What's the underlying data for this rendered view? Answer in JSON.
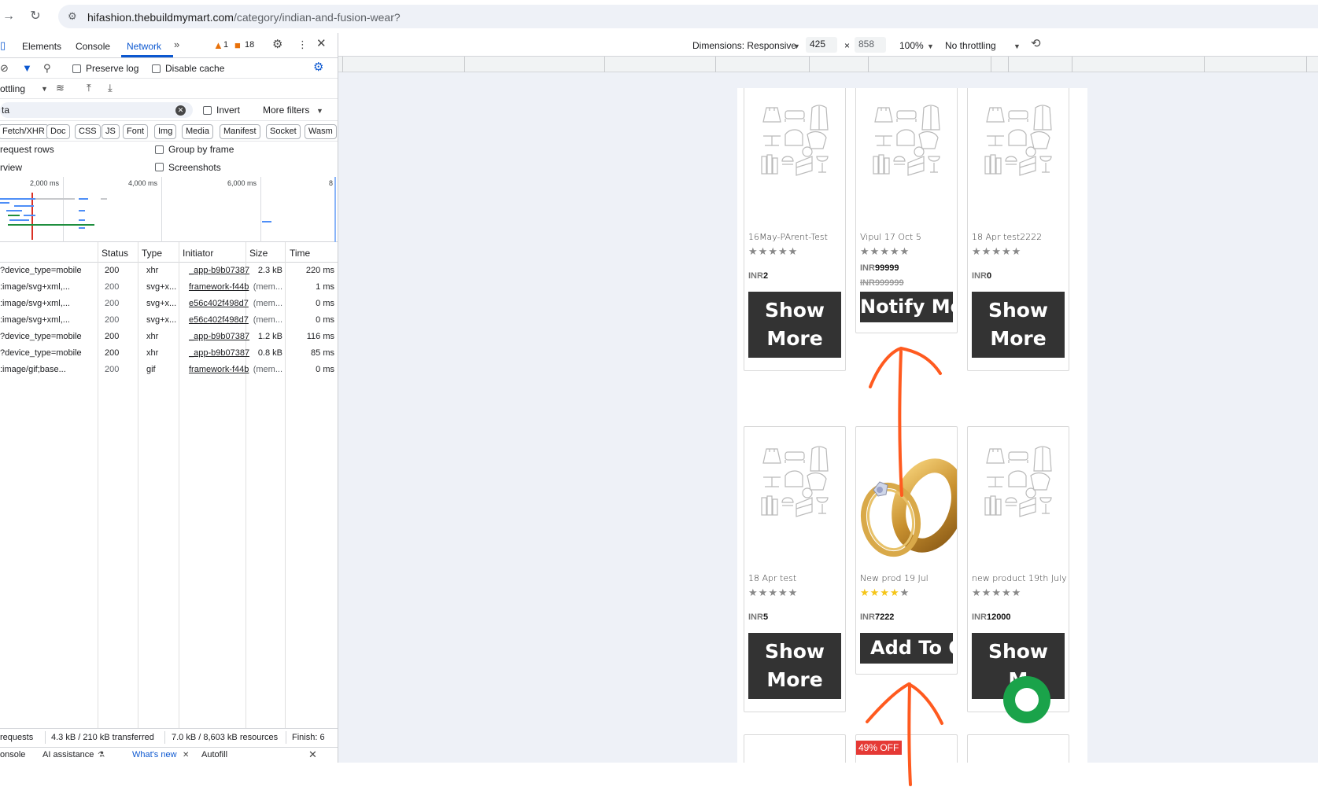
{
  "browser": {
    "url_host": "hifashion.thebuildmymart.com",
    "url_path": "/category/indian-and-fusion-wear?",
    "back_icon": "back-arrow-icon",
    "reload_icon": "reload-icon"
  },
  "devtools": {
    "tabs": [
      "Elements",
      "Console",
      "Network"
    ],
    "warnings_count": "1",
    "issues_count": "18",
    "preserve_log": "Preserve log",
    "disable_cache": "Disable cache",
    "throttling": "ottling",
    "filter_value": "ta",
    "invert": "Invert",
    "more_filters": "More filters",
    "chips": [
      "Fetch/XHR",
      "Doc",
      "CSS",
      "JS",
      "Font",
      "Img",
      "Media",
      "Manifest",
      "Socket",
      "Wasm"
    ],
    "big_request_rows": "request rows",
    "group_by_frame": "Group by frame",
    "overview": "rview",
    "screenshots": "Screenshots",
    "timeline_ticks": [
      "2,000 ms",
      "4,000 ms",
      "6,000 ms",
      "8"
    ],
    "columns": [
      "Status",
      "Type",
      "Initiator",
      "Size",
      "Time"
    ],
    "rows": [
      {
        "name": "?device_type=mobile",
        "status": "200",
        "type": "xhr",
        "initiator": "_app-b9b07387",
        "size": "2.3 kB",
        "time": "220 ms",
        "muted": false
      },
      {
        "name": ":image/svg+xml,...",
        "status": "200",
        "type": "svg+x...",
        "initiator": "framework-f44b",
        "size": "(mem...",
        "time": "1 ms",
        "muted": true
      },
      {
        "name": ":image/svg+xml,...",
        "status": "200",
        "type": "svg+x...",
        "initiator": "e56c402f498d7",
        "size": "(mem...",
        "time": "0 ms",
        "muted": true
      },
      {
        "name": ":image/svg+xml,...",
        "status": "200",
        "type": "svg+x...",
        "initiator": "e56c402f498d7",
        "size": "(mem...",
        "time": "0 ms",
        "muted": true
      },
      {
        "name": "?device_type=mobile",
        "status": "200",
        "type": "xhr",
        "initiator": "_app-b9b07387",
        "size": "1.2 kB",
        "time": "116 ms",
        "muted": false
      },
      {
        "name": "?device_type=mobile",
        "status": "200",
        "type": "xhr",
        "initiator": "_app-b9b07387",
        "size": "0.8 kB",
        "time": "85 ms",
        "muted": false
      },
      {
        "name": ":image/gif;base...",
        "status": "200",
        "type": "gif",
        "initiator": "framework-f44b",
        "size": "(mem...",
        "time": "0 ms",
        "muted": true
      }
    ],
    "status_requests": "requests",
    "status_transferred": "4.3 kB / 210 kB transferred",
    "status_resources": "7.0 kB / 8,603 kB resources",
    "status_finish": "Finish: 6",
    "drawer_tabs": [
      "onsole",
      "AI assistance",
      "What's new",
      "Autofill"
    ]
  },
  "device": {
    "dimensions_label": "Dimensions: Responsive",
    "width": "425",
    "times": "×",
    "height": "858",
    "zoom": "100%",
    "throttle": "No throttling"
  },
  "products": [
    {
      "name": "16May-PArent-Test",
      "currency": "INR",
      "price": "2",
      "strike": "",
      "rating": 0,
      "button": [
        "Show",
        "More"
      ]
    },
    {
      "name": "Vipul 17 Oct 5",
      "currency": "INR",
      "price": "99999",
      "strike": "INR999999",
      "rating": 0,
      "button": [
        "Notify Me!"
      ]
    },
    {
      "name": "18 Apr test2222",
      "currency": "INR",
      "price": "0",
      "strike": "",
      "rating": 0,
      "button": [
        "Show",
        "More"
      ]
    },
    {
      "name": "18 Apr test",
      "currency": "INR",
      "price": "5",
      "strike": "",
      "rating": 0,
      "button": [
        "Show",
        "More"
      ]
    },
    {
      "name": "New prod 19 Jul",
      "currency": "INR",
      "price": "7222",
      "strike": "",
      "rating": 4,
      "button": [
        "Add To C"
      ]
    },
    {
      "name": "new product 19th July",
      "currency": "INR",
      "price": "12000",
      "strike": "",
      "rating": 0,
      "button": [
        "Show",
        "M"
      ]
    }
  ],
  "discount_badge": "49% OFF",
  "colors": {
    "accent": "#0b57d0",
    "button_dark": "#333333",
    "star_gold": "#f5c518",
    "badge_red": "#e53935",
    "chat_green": "#1aa34a",
    "annotation_orange": "#ff5a1f"
  }
}
